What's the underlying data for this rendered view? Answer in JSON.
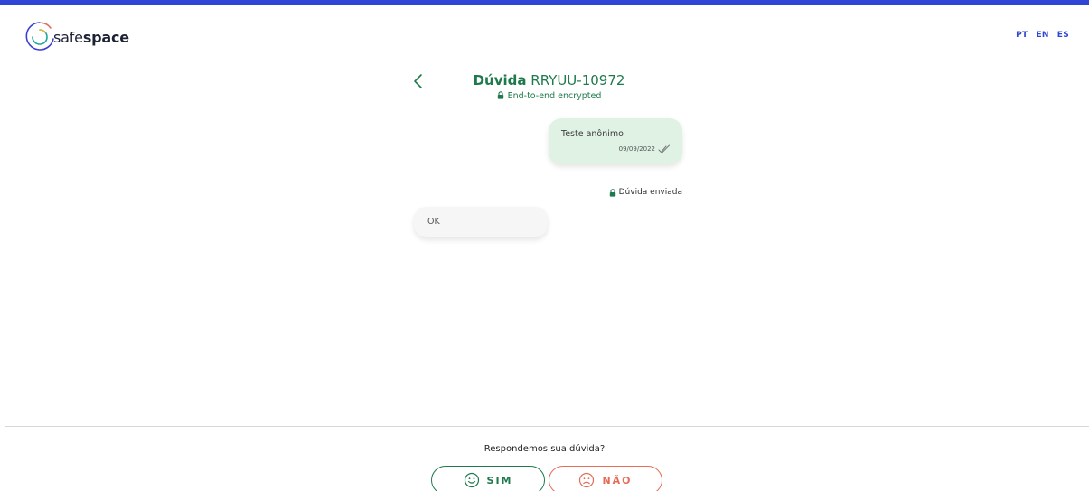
{
  "brand": {
    "name_light": "safe",
    "name_bold": "space",
    "logo_icon": "safespace-logo-icon"
  },
  "languages": [
    "PT",
    "EN",
    "ES"
  ],
  "conversation": {
    "title_bold": "Dúvida",
    "title_id": "RRYUU-10972",
    "encrypted_label": "End-to-end encrypted",
    "back_icon": "chevron-left-icon"
  },
  "messages": [
    {
      "direction": "sent",
      "text": "Teste anônimo",
      "date": "09/09/2022",
      "status_icon": "double-check-icon"
    },
    {
      "direction": "received",
      "text": "OK"
    }
  ],
  "status": {
    "label": "Dúvida enviada",
    "icon": "lock-icon"
  },
  "feedback": {
    "question": "Respondemos sua dúvida?",
    "yes_label": "SIM",
    "yes_icon": "smile-icon",
    "no_label": "NÃO",
    "no_icon": "sad-face-icon"
  },
  "colors": {
    "accent_blue": "#2f45d6",
    "brand_green": "#1e7a4c",
    "sent_bubble": "#dff2e4",
    "received_bubble": "#f6f6f6",
    "no_red": "#e56d57"
  }
}
